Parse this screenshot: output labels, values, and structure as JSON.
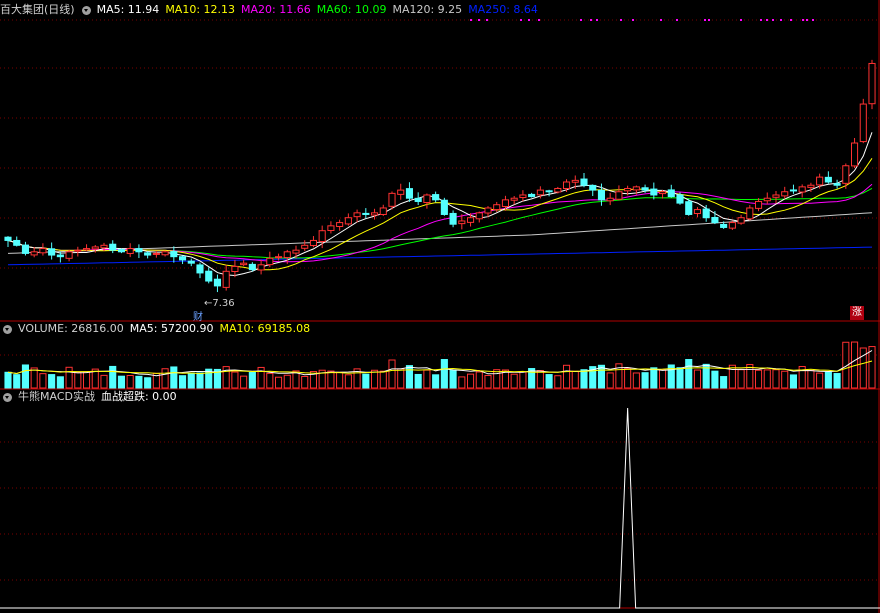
{
  "main_panel": {
    "stock_name": "百大集团(日线)",
    "ma": [
      {
        "label": "MA5: 11.94",
        "color": "#ffffff"
      },
      {
        "label": "MA10: 12.13",
        "color": "#ffff00"
      },
      {
        "label": "MA20: 11.66",
        "color": "#ff00ff"
      },
      {
        "label": "MA60: 10.09",
        "color": "#00ff00"
      },
      {
        "label": "MA120: 9.25",
        "color": "#c8c8c8"
      },
      {
        "label": "MA250: 8.64",
        "color": "#0020ff"
      }
    ],
    "low_label": "←7.36",
    "cai_marker": "财",
    "zhang_marker": "涨"
  },
  "volume_panel": {
    "volume_label": "VOLUME: 26816.00",
    "ma5_label": "MA5: 57200.90",
    "ma10_label": "MA10: 69185.08",
    "ma5_color": "#ffffff",
    "ma10_color": "#ffff00"
  },
  "indicator_panel": {
    "name": "牛熊MACD实战",
    "value_label": "血战超跌: 0.00"
  },
  "colors": {
    "up": "#ff3232",
    "down": "#54ffff",
    "grid": "#7a0000",
    "border": "#b00000"
  },
  "chart_data": {
    "type": "candlestick",
    "price_range": [
      6.5,
      15.8
    ],
    "closes": [
      8.95,
      8.8,
      8.55,
      8.6,
      8.7,
      8.5,
      8.45,
      8.6,
      8.65,
      8.7,
      8.75,
      8.8,
      8.65,
      8.6,
      8.7,
      8.6,
      8.5,
      8.55,
      8.6,
      8.45,
      8.35,
      8.25,
      7.95,
      7.7,
      7.55,
      8.0,
      8.15,
      8.25,
      8.05,
      8.2,
      8.4,
      8.45,
      8.6,
      8.65,
      8.8,
      8.95,
      9.25,
      9.4,
      9.5,
      9.65,
      9.8,
      9.75,
      9.8,
      9.95,
      10.4,
      10.5,
      10.25,
      10.15,
      10.35,
      10.2,
      9.75,
      9.45,
      9.55,
      9.65,
      9.8,
      9.95,
      10.05,
      10.2,
      10.25,
      10.35,
      10.3,
      10.5,
      10.45,
      10.55,
      10.75,
      10.8,
      10.65,
      10.5,
      10.2,
      10.25,
      10.45,
      10.55,
      10.6,
      10.5,
      10.35,
      10.45,
      10.3,
      10.1,
      9.75,
      9.9,
      9.65,
      9.5,
      9.35,
      9.5,
      9.65,
      9.95,
      10.15,
      10.25,
      10.35,
      10.45,
      10.5,
      10.6,
      10.65,
      10.9,
      10.75,
      10.65,
      11.25,
      11.95,
      13.15,
      14.4
    ],
    "volume_max": 12000,
    "indicator": {
      "name": "血战超跌",
      "spike_index": 71,
      "value": 1.0
    }
  }
}
